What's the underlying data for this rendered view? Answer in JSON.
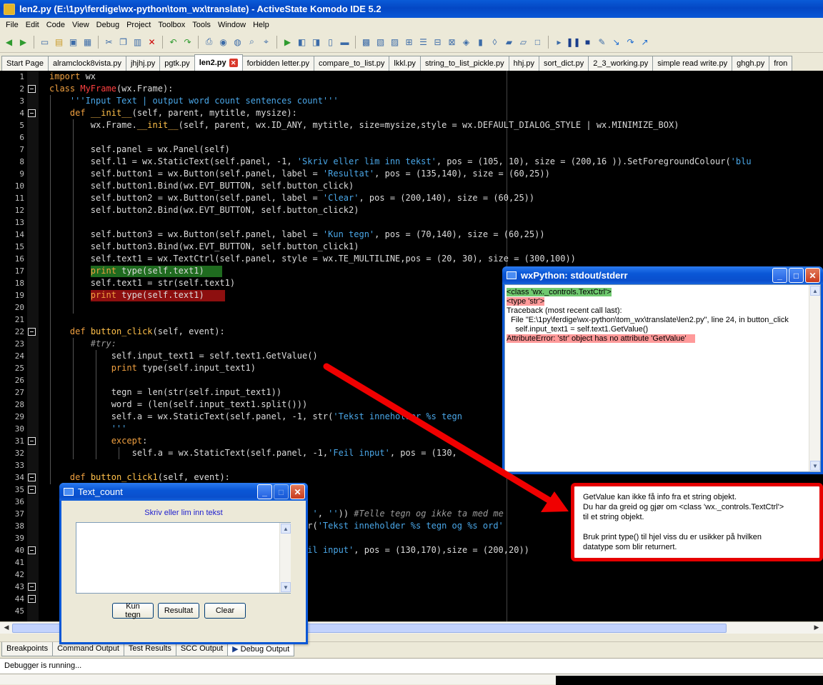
{
  "window": {
    "title": "len2.py (E:\\1py\\ferdige\\wx-python\\tom_wx\\translate) - ActiveState Komodo IDE 5.2"
  },
  "menu": [
    "File",
    "Edit",
    "Code",
    "View",
    "Debug",
    "Project",
    "Toolbox",
    "Tools",
    "Window",
    "Help"
  ],
  "tabs": [
    {
      "label": "Start Page"
    },
    {
      "label": "alramclock8vista.py"
    },
    {
      "label": "jhjhj.py"
    },
    {
      "label": "pgtk.py"
    },
    {
      "label": "len2.py",
      "active": true
    },
    {
      "label": "forbidden letter.py"
    },
    {
      "label": "compare_to_list.py"
    },
    {
      "label": "lkkl.py"
    },
    {
      "label": "string_to_list_pickle.py"
    },
    {
      "label": "hhj.py"
    },
    {
      "label": "sort_dict.py"
    },
    {
      "label": "2_3_working.py"
    },
    {
      "label": "simple read write.py"
    },
    {
      "label": "ghgh.py"
    },
    {
      "label": "fron"
    }
  ],
  "code": [
    "import wx",
    "class MyFrame(wx.Frame):",
    "    '''Input Text | output word count sentences count'''",
    "    def __init__(self, parent, mytitle, mysize):",
    "        wx.Frame.__init__(self, parent, wx.ID_ANY, mytitle, size=mysize,style = wx.DEFAULT_DIALOG_STYLE | wx.MINIMIZE_BOX)",
    "",
    "        self.panel = wx.Panel(self)",
    "        self.l1 = wx.StaticText(self.panel, -1, 'Skriv eller lim inn tekst', pos = (105, 10), size = (200,16 )).SetForegroundColour('blu",
    "        self.button1 = wx.Button(self.panel, label = 'Resultat', pos = (135,140), size = (60,25))",
    "        self.button1.Bind(wx.EVT_BUTTON, self.button_click)",
    "        self.button2 = wx.Button(self.panel, label = 'Clear', pos = (200,140), size = (60,25))",
    "        self.button2.Bind(wx.EVT_BUTTON, self.button_click2)",
    "",
    "        self.button3 = wx.Button(self.panel, label = 'Kun tegn', pos = (70,140), size = (60,25))",
    "        self.button3.Bind(wx.EVT_BUTTON, self.button_click1)",
    "        self.text1 = wx.TextCtrl(self.panel, style = wx.TE_MULTILINE,pos = (20, 30), size = (300,100))",
    "        print type(self.text1)",
    "        self.text1 = str(self.text1)",
    "        print type(self.text1)",
    "",
    "",
    "    def button_click(self, event):",
    "        #try:",
    "            self.input_text1 = self.text1.GetValue()",
    "            print type(self.input_text1)",
    "",
    "            tegn = len(str(self.input_text1))",
    "            word = (len(self.input_text1.split()))",
    "            self.a = wx.StaticText(self.panel, -1, str('Tekst inneholder %s tegn",
    "            '''",
    "            except:",
    "                self.a = wx.StaticText(self.panel, -1,'Feil input', pos = (130,",
    "",
    "    def button_click1(self, event):",
    "                                          Value()",
    "                                          t()))",
    "                                          eplace(' ', '')) #Telle tegn og ikke ta med me",
    "                                          , -1, str('Tekst inneholder %s tegn og %s ord'",
    "",
    "                                          , -1,'Feil input', pos = (130,170),size = (200,20))",
    "",
    "",
    "",
    "",
    ""
  ],
  "wx_output": {
    "title": "wxPython: stdout/stderr",
    "lines": [
      "<class 'wx._controls.TextCtrl'>",
      "<type 'str'>",
      "Traceback (most recent call last):",
      "  File \"E:\\1py\\ferdige\\wx-python\\tom_wx\\translate\\len2.py\", line 24, in button_click",
      "    self.input_text1 = self.text1.GetValue()",
      "AttributeError: 'str' object has no attribute 'GetValue'"
    ]
  },
  "text_count": {
    "title": "Text_count",
    "label": "Skriv eller lim inn tekst",
    "textarea_value": "",
    "buttons": {
      "kun_tegn": "Kun tegn",
      "resultat": "Resultat",
      "clear": "Clear"
    }
  },
  "callout": {
    "p1": "GetValue kan ikke få info fra et string objekt.",
    "p2": "Du har da greid og gjør om <class 'wx._controls.TextCtrl'>",
    "p3": "til et string objekt.",
    "p4": "Bruk print type() til hjel viss du er usikker på hvilken",
    "p5": "datatype som blir returnert."
  },
  "bottom_tabs": [
    "Breakpoints",
    "Command Output",
    "Test Results",
    "SCC Output",
    "Debug Output"
  ],
  "status": "Debugger is running...",
  "colors": {
    "accent": "#0a57d6",
    "callout_border": "#e60000"
  }
}
